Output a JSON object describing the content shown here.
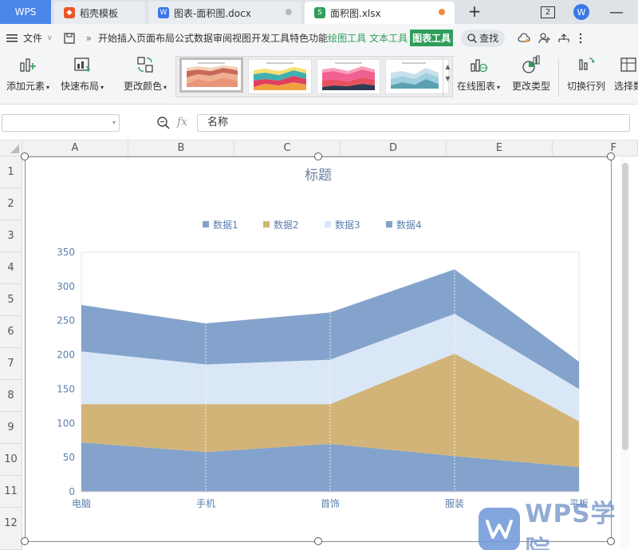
{
  "tabs": {
    "wps": "WPS",
    "template": "稻壳模板",
    "doc": "图表-面积图.docx",
    "xlsx": "面积图.xlsx",
    "plus": "+",
    "badge": "2"
  },
  "menu": {
    "file": "文件",
    "items": [
      "开始",
      "插入",
      "页面布局",
      "公式",
      "数据",
      "审阅",
      "视图",
      "开发工具",
      "特色功能"
    ],
    "drawing_tools": "绘图工具",
    "text_tools": "文本工具",
    "chart_tools": "图表工具",
    "search": "查找"
  },
  "ribbon": {
    "add_element": "添加元素",
    "quick_layout": "快速布局",
    "change_color": "更改颜色",
    "online_chart": "在线图表",
    "change_type": "更改类型",
    "switch_row_col": "切换行列",
    "select_data": "选择数"
  },
  "formula": {
    "fx": "fx",
    "value": "名称"
  },
  "grid": {
    "columns": [
      "A",
      "B",
      "C",
      "D",
      "E",
      "F"
    ],
    "rows": [
      "1",
      "2",
      "3",
      "4",
      "5",
      "6",
      "7",
      "8",
      "9",
      "10",
      "11",
      "12"
    ]
  },
  "colors": {
    "series1": "#84a3cc",
    "series2": "#d2b478",
    "series3": "#dae7f7",
    "series4": "#84a3cc",
    "active_tab_green": "#2f9e5b",
    "wps_blue": "#4a86e8",
    "axis_text": "#5b7fae"
  },
  "chart_data": {
    "type": "area",
    "stacked": true,
    "title": "标题",
    "categories": [
      "电脑",
      "手机",
      "首饰",
      "服装",
      "平板"
    ],
    "series": [
      {
        "name": "数据1",
        "values": [
          72,
          58,
          70,
          52,
          36
        ]
      },
      {
        "name": "数据2",
        "values": [
          56,
          70,
          58,
          150,
          67
        ]
      },
      {
        "name": "数据3",
        "values": [
          77,
          58,
          65,
          58,
          47
        ]
      },
      {
        "name": "数据4",
        "values": [
          68,
          60,
          69,
          65,
          40
        ]
      }
    ],
    "ylim": [
      0,
      350
    ],
    "yticks": [
      0,
      50,
      100,
      150,
      200,
      250,
      300,
      350
    ],
    "legend_position": "top",
    "grid": "vertical"
  },
  "watermark": "WPS学院"
}
